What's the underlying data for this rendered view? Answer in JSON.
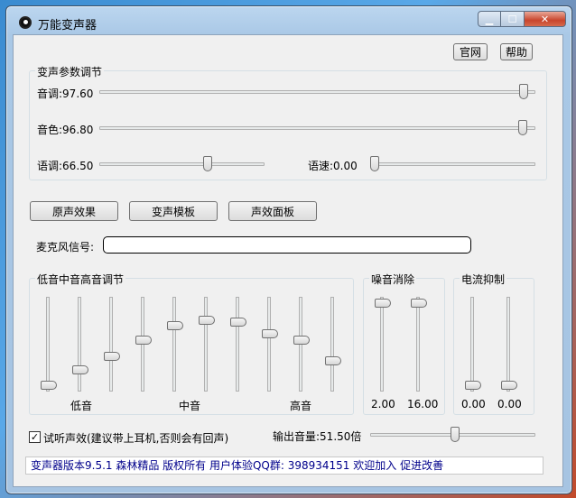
{
  "window": {
    "title": "万能变声器"
  },
  "header_buttons": {
    "website": "官网",
    "help": "帮助"
  },
  "voice_params": {
    "group_label": "变声参数调节",
    "pitch": {
      "label": "音调:97.60",
      "value": 97.6
    },
    "timbre": {
      "label": "音色:96.80",
      "value": 96.8
    },
    "tone": {
      "label": "语调:66.50",
      "value": 66.5
    },
    "speed": {
      "label": "语速:0.00",
      "value": 0.0
    }
  },
  "mode_buttons": {
    "original": "原声效果",
    "template": "变声模板",
    "effects": "声效面板"
  },
  "mic": {
    "label": "麦克风信号:"
  },
  "eq": {
    "group_label": "低音中音高音调节",
    "band_levels": [
      0.0,
      0.19,
      0.35,
      0.55,
      0.73,
      0.79,
      0.77,
      0.63,
      0.55,
      0.3
    ],
    "labels": {
      "low": "低音",
      "mid": "中音",
      "high": "高音"
    }
  },
  "noise": {
    "group_label": "噪音消除",
    "values": [
      "2.00",
      "16.00"
    ],
    "levels": [
      1.0,
      1.0
    ]
  },
  "current": {
    "group_label": "电流抑制",
    "values": [
      "0.00",
      "0.00"
    ],
    "levels": [
      0.0,
      0.0
    ]
  },
  "monitor": {
    "checked": true,
    "label": "试听声效(建议带上耳机,否则会有回声)"
  },
  "output_volume": {
    "label": "输出音量:51.50倍",
    "value": 51.5,
    "max": 100
  },
  "status": {
    "text": "变声器版本9.5.1 森林精品 版权所有 用户体验QQ群: 398934151 欢迎加入 促进改善"
  }
}
